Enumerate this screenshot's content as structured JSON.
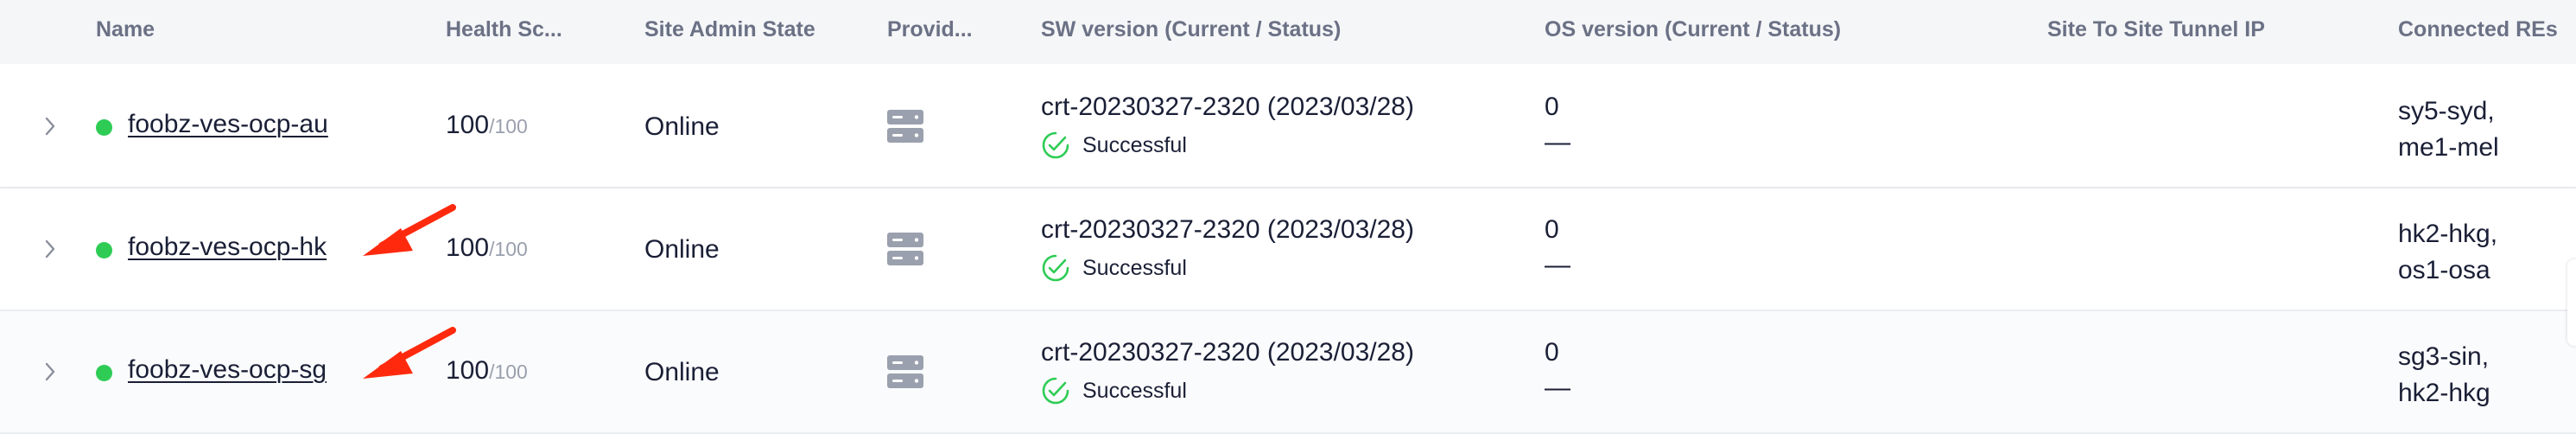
{
  "columns": {
    "name": "Name",
    "health": "Health Sc...",
    "admin_state": "Site Admin State",
    "provider": "Provid...",
    "sw_version": "SW version (Current / Status)",
    "os_version": "OS version (Current / Status)",
    "tunnel_ip": "Site To Site Tunnel IP",
    "connected_res": "Connected REs"
  },
  "colors": {
    "status_online": "#2ecc55",
    "success_check": "#2ecc55",
    "annotation_arrow": "#ff2a0e"
  },
  "rows": [
    {
      "name": "foobz-ves-ocp-au",
      "health_value": "100",
      "health_max": "/100",
      "admin_state": "Online",
      "provider_icon": "server-icon",
      "sw_version": "crt-20230327-2320 (2023/03/28)",
      "sw_status": "Successful",
      "os_version": "0",
      "os_status": "—",
      "tunnel_ip": "",
      "re_line1": "sy5-syd,",
      "re_line2": "me1-mel",
      "annotated": false
    },
    {
      "name": "foobz-ves-ocp-hk",
      "health_value": "100",
      "health_max": "/100",
      "admin_state": "Online",
      "provider_icon": "server-icon",
      "sw_version": "crt-20230327-2320 (2023/03/28)",
      "sw_status": "Successful",
      "os_version": "0",
      "os_status": "—",
      "tunnel_ip": "",
      "re_line1": "hk2-hkg,",
      "re_line2": "os1-osa",
      "annotated": true
    },
    {
      "name": "foobz-ves-ocp-sg",
      "health_value": "100",
      "health_max": "/100",
      "admin_state": "Online",
      "provider_icon": "server-icon",
      "sw_version": "crt-20230327-2320 (2023/03/28)",
      "sw_status": "Successful",
      "os_version": "0",
      "os_status": "—",
      "tunnel_ip": "",
      "re_line1": "sg3-sin,",
      "re_line2": "hk2-hkg",
      "annotated": true
    }
  ]
}
